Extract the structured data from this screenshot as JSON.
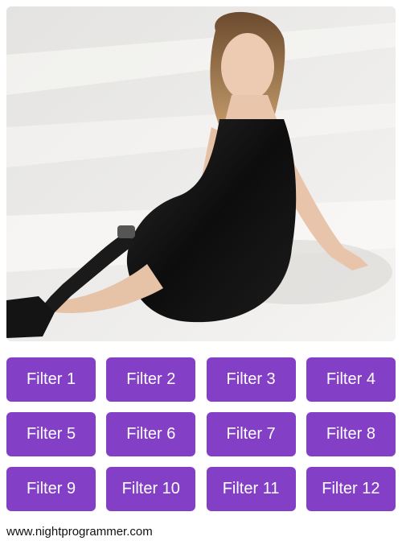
{
  "photo": {
    "subject": "woman in black slip dress with prosthetic leg sitting on white floor"
  },
  "filters": [
    {
      "label": "Filter 1"
    },
    {
      "label": "Filter 2"
    },
    {
      "label": "Filter 3"
    },
    {
      "label": "Filter 4"
    },
    {
      "label": "Filter 5"
    },
    {
      "label": "Filter 6"
    },
    {
      "label": "Filter 7"
    },
    {
      "label": "Filter 8"
    },
    {
      "label": "Filter 9"
    },
    {
      "label": "Filter 10"
    },
    {
      "label": "Filter 11"
    },
    {
      "label": "Filter 12"
    }
  ],
  "footer": {
    "link_text": "www.nightprogrammer.com"
  },
  "colors": {
    "button_bg": "#8340c6",
    "button_text": "#ffffff",
    "background": "#ffffff"
  }
}
